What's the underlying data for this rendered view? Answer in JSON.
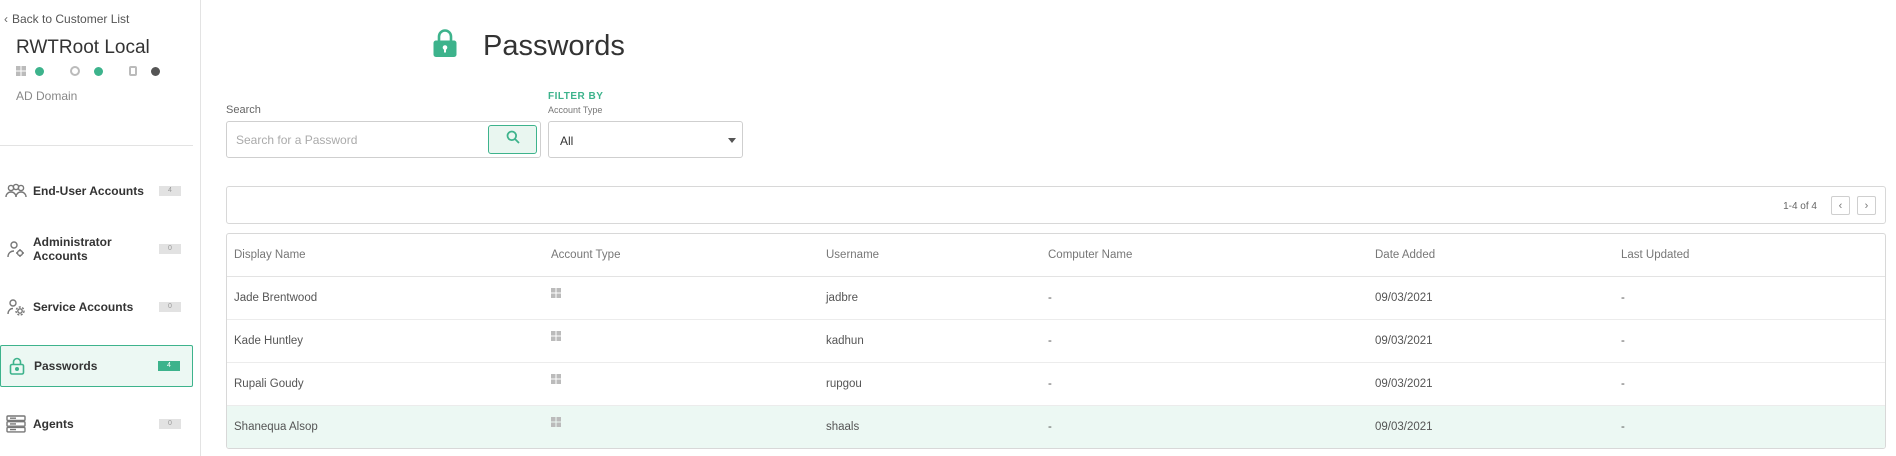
{
  "sidebar": {
    "back_label": "Back to Customer List",
    "customer_name": "RWTRoot Local",
    "domain_label": "AD Domain",
    "items": [
      {
        "label": "End-User Accounts",
        "count": "4",
        "icon": "users-icon",
        "active": false
      },
      {
        "label": "Administrator Accounts",
        "count": "0",
        "icon": "admin-user-icon",
        "active": false
      },
      {
        "label": "Service Accounts",
        "count": "0",
        "icon": "service-gear-icon",
        "active": false
      },
      {
        "label": "Passwords",
        "count": "4",
        "icon": "lock-icon",
        "active": true
      },
      {
        "label": "Agents",
        "count": "0",
        "icon": "server-icon",
        "active": false
      }
    ]
  },
  "header": {
    "title": "Passwords",
    "icon": "lock-icon"
  },
  "search": {
    "label": "Search",
    "placeholder": "Search for a Password",
    "value": ""
  },
  "filter": {
    "heading": "FILTER BY",
    "sublabel": "Account Type",
    "selected": "All"
  },
  "pagination": {
    "text": "1-4 of 4"
  },
  "table": {
    "columns": [
      "Display Name",
      "Account Type",
      "Username",
      "Computer Name",
      "Date Added",
      "Last Updated"
    ],
    "rows": [
      {
        "display_name": "Jade Brentwood",
        "account_type": "windows-icon",
        "username": "jadbre",
        "computer_name": "-",
        "date_added": "09/03/2021",
        "last_updated": "-"
      },
      {
        "display_name": "Kade Huntley",
        "account_type": "windows-icon",
        "username": "kadhun",
        "computer_name": "-",
        "date_added": "09/03/2021",
        "last_updated": "-"
      },
      {
        "display_name": "Rupali Goudy",
        "account_type": "windows-icon",
        "username": "rupgou",
        "computer_name": "-",
        "date_added": "09/03/2021",
        "last_updated": "-"
      },
      {
        "display_name": "Shanequa Alsop",
        "account_type": "windows-icon",
        "username": "shaals",
        "computer_name": "-",
        "date_added": "09/03/2021",
        "last_updated": "-"
      }
    ]
  },
  "colors": {
    "accent": "#3db38c",
    "accent_light": "#ecf8f3",
    "status_dot_dark": "#555555"
  }
}
